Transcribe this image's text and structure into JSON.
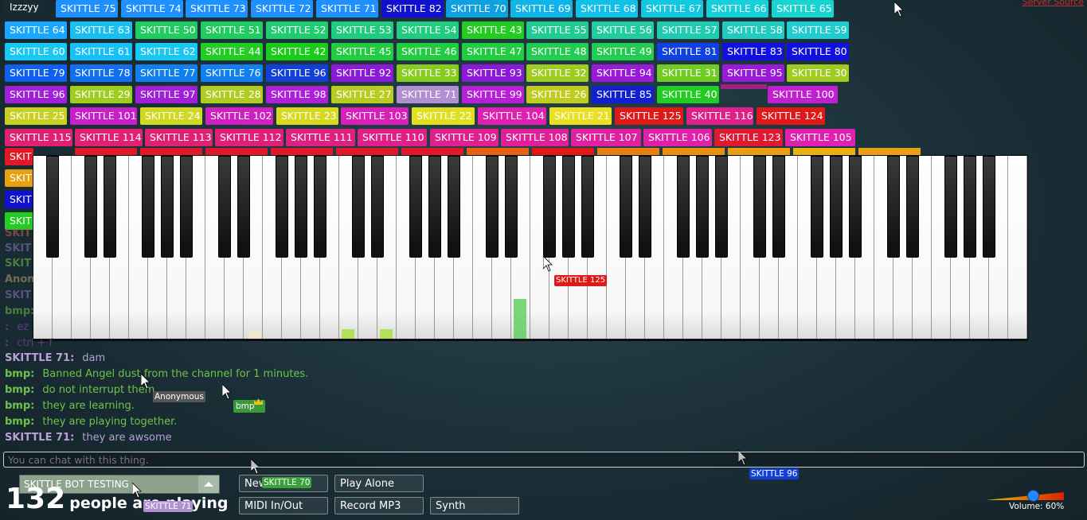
{
  "me_tag": "Izzzyy",
  "server_source": "Server Source",
  "users": [
    {
      "name": "SKITTLE 75",
      "bg": "#1e90ff"
    },
    {
      "name": "SKITTLE 74",
      "bg": "#1e90ff"
    },
    {
      "name": "SKITTLE 73",
      "bg": "#1e90ff"
    },
    {
      "name": "SKITTLE 72",
      "bg": "#1e90ff"
    },
    {
      "name": "SKITTLE 71",
      "bg": "#1e90ff"
    },
    {
      "name": "SKITTLE 82",
      "bg": "#1010d0"
    },
    {
      "name": "SKITTLE 70",
      "bg": "#0fa0e0"
    },
    {
      "name": "SKITTLE 69",
      "bg": "#0fb4e8"
    },
    {
      "name": "SKITTLE 68",
      "bg": "#10c0e8"
    },
    {
      "name": "SKITTLE 67",
      "bg": "#12c8e0"
    },
    {
      "name": "SKITTLE 66",
      "bg": "#15d0d8"
    },
    {
      "name": "SKITTLE 65",
      "bg": "#17d4d0"
    },
    {
      "name": "SKITTLE 64",
      "bg": "#1aa8ff"
    },
    {
      "name": "SKITTLE 63",
      "bg": "#18bff0"
    },
    {
      "name": "SKITTLE 50",
      "bg": "#20cc60"
    },
    {
      "name": "SKITTLE 51",
      "bg": "#20cc60"
    },
    {
      "name": "SKITTLE 52",
      "bg": "#20cc70"
    },
    {
      "name": "SKITTLE 53",
      "bg": "#20cc80"
    },
    {
      "name": "SKITTLE 54",
      "bg": "#20cc80"
    },
    {
      "name": "SKITTLE 43",
      "bg": "#22cc22"
    },
    {
      "name": "SKITTLE 55",
      "bg": "#20cc90"
    },
    {
      "name": "SKITTLE 56",
      "bg": "#20cca0"
    },
    {
      "name": "SKITTLE 57",
      "bg": "#20ccb0"
    },
    {
      "name": "SKITTLE 58",
      "bg": "#20ccc0"
    },
    {
      "name": "SKITTLE 59",
      "bg": "#20ccd0"
    },
    {
      "name": "SKITTLE 60",
      "bg": "#18c8f0"
    },
    {
      "name": "SKITTLE 61",
      "bg": "#18c0f8"
    },
    {
      "name": "SKITTLE 62",
      "bg": "#18c8f0"
    },
    {
      "name": "SKITTLE 44",
      "bg": "#22cc22"
    },
    {
      "name": "SKITTLE 42",
      "bg": "#18cc18"
    },
    {
      "name": "SKITTLE 45",
      "bg": "#22cc40"
    },
    {
      "name": "SKITTLE 46",
      "bg": "#22cc40"
    },
    {
      "name": "SKITTLE 47",
      "bg": "#22cc40"
    },
    {
      "name": "SKITTLE 48",
      "bg": "#22cc50"
    },
    {
      "name": "SKITTLE 49",
      "bg": "#22cc50"
    },
    {
      "name": "SKITTLE 81",
      "bg": "#1040e0"
    },
    {
      "name": "SKITTLE 83",
      "bg": "#1010e0"
    },
    {
      "name": "SKITTLE 80",
      "bg": "#1010e0"
    },
    {
      "name": "SKITTLE 79",
      "bg": "#1060f0"
    },
    {
      "name": "SKITTLE 78",
      "bg": "#1070f0"
    },
    {
      "name": "SKITTLE 77",
      "bg": "#1080f0"
    },
    {
      "name": "SKITTLE 76",
      "bg": "#1080f0"
    },
    {
      "name": "SKITTLE 96",
      "bg": "#1040d8"
    },
    {
      "name": "SKITTLE 92",
      "bg": "#8a1ad8"
    },
    {
      "name": "SKITTLE 33",
      "bg": "#88cc22"
    },
    {
      "name": "SKITTLE 93",
      "bg": "#8a1ad8"
    },
    {
      "name": "SKITTLE 32",
      "bg": "#a0cc22"
    },
    {
      "name": "SKITTLE 94",
      "bg": "#9a1ad8"
    },
    {
      "name": "SKITTLE 31",
      "bg": "#70cc22"
    },
    {
      "name": "SKITTLE 95",
      "bg": "#9a1ad8"
    },
    {
      "name": "SKITTLE 30",
      "bg": "#a0cc22"
    },
    {
      "name": "SKITTLE 96",
      "bg": "#a020d8"
    },
    {
      "name": "SKITTLE 29",
      "bg": "#a0cc22"
    },
    {
      "name": "SKITTLE 97",
      "bg": "#a020d8"
    },
    {
      "name": "SKITTLE 28",
      "bg": "#b0cc22"
    },
    {
      "name": "SKITTLE 98",
      "bg": "#b020d8"
    },
    {
      "name": "SKITTLE 27",
      "bg": "#b8cc22"
    },
    {
      "name": "SKITTLE 71",
      "bg": "#b090d0"
    },
    {
      "name": "SKITTLE 99",
      "bg": "#b820d8"
    },
    {
      "name": "SKITTLE 26",
      "bg": "#c0cc22"
    },
    {
      "name": "SKITTLE 85",
      "bg": "#1020d0"
    },
    {
      "name": "SKITTLE 40",
      "bg": "#22cc22"
    },
    {
      "name": "SKITTLE 100",
      "bg": "#c020d0"
    },
    {
      "name": "SKITTLE 25",
      "bg": "#c8d022"
    },
    {
      "name": "SKITTLE 101",
      "bg": "#c820c8"
    },
    {
      "name": "SKITTLE 24",
      "bg": "#d0d822"
    },
    {
      "name": "SKITTLE 102",
      "bg": "#d020c0"
    },
    {
      "name": "SKITTLE 23",
      "bg": "#d8d820"
    },
    {
      "name": "SKITTLE 103",
      "bg": "#d820b8"
    },
    {
      "name": "SKITTLE 22",
      "bg": "#e0e020"
    },
    {
      "name": "SKITTLE 104",
      "bg": "#e020b0"
    },
    {
      "name": "SKITTLE 21",
      "bg": "#e8e020"
    },
    {
      "name": "SKITTLE 125",
      "bg": "#e01818"
    },
    {
      "name": "SKITTLE 116",
      "bg": "#e0208a"
    },
    {
      "name": "SKITTLE 124",
      "bg": "#e01818"
    },
    {
      "name": "SKITTLE 115",
      "bg": "#e02070"
    },
    {
      "name": "SKITTLE 114",
      "bg": "#e02070"
    },
    {
      "name": "SKITTLE 113",
      "bg": "#e02070"
    },
    {
      "name": "SKITTLE 112",
      "bg": "#e02078"
    },
    {
      "name": "SKITTLE 111",
      "bg": "#e02080"
    },
    {
      "name": "SKITTLE 110",
      "bg": "#e02088"
    },
    {
      "name": "SKITTLE 109",
      "bg": "#e02090"
    },
    {
      "name": "SKITTLE 108",
      "bg": "#e02098"
    },
    {
      "name": "SKITTLE 107",
      "bg": "#e020a0"
    },
    {
      "name": "SKITTLE 106",
      "bg": "#e020a8"
    },
    {
      "name": "SKITTLE 123",
      "bg": "#e01830"
    },
    {
      "name": "SKITTLE 105",
      "bg": "#e020b0"
    }
  ],
  "partial_tags": [
    {
      "name": "SKIT",
      "bg": "#e01828"
    },
    {
      "name": "SKIT",
      "bg": "#e8a010"
    },
    {
      "name": "SKIT",
      "bg": "#1010d0"
    },
    {
      "name": "SKIT",
      "bg": "#22cc22"
    }
  ],
  "key_labels": {
    "skittle125": "SKITTLE 125"
  },
  "chat": [
    {
      "name": "SKITTLE 71:",
      "msg": "dam",
      "color": "#b8a0d8"
    },
    {
      "name": "bmp:",
      "msg": "Banned Angel dust from the channel for 1 minutes.",
      "color": "#6ec24a"
    },
    {
      "name": "bmp:",
      "msg": "do not interrupt them",
      "color": "#6ec24a"
    },
    {
      "name": "bmp:",
      "msg": "they are learning.",
      "color": "#6ec24a"
    },
    {
      "name": "bmp:",
      "msg": "they are playing together.",
      "color": "#6ec24a"
    },
    {
      "name": "SKITTLE 71:",
      "msg": "they are awsome",
      "color": "#b8a0d8"
    }
  ],
  "chat_faded": [
    {
      "name": "SKIT",
      "msg": "",
      "color": "#c06060"
    },
    {
      "name": "SKIT",
      "msg": "",
      "color": "#9070c0"
    },
    {
      "name": "SKIT",
      "msg": "",
      "color": "#6ec24a"
    },
    {
      "name": "Anon",
      "msg": "",
      "color": "#c0a070"
    },
    {
      "name": "SKIT",
      "msg": "",
      "color": "#9070c0"
    },
    {
      "name": "bmp:",
      "msg": "",
      "color": "#6ec24a"
    },
    {
      "name": ":",
      "msg": "ez",
      "color": "#a040c0"
    },
    {
      "name": ":",
      "msg": "ctrl + f",
      "color": "#a040c0"
    }
  ],
  "cursor_labels": {
    "anonymous": "Anonymous",
    "bmp": "bmp",
    "skittle96": "SKITTLE 96",
    "skittle70": "SKITTLE 70",
    "skittle71": "SKITTLE 71"
  },
  "chat_input_placeholder": "You can chat with this thing.",
  "room": {
    "name": "SKITTLE BOT TESTING"
  },
  "buttons": {
    "new": "New",
    "play_alone": "Play Alone",
    "midi": "MIDI In/Out",
    "record": "Record MP3",
    "synth": "Synth"
  },
  "people": {
    "count": "132",
    "label": "people are playing"
  },
  "volume": {
    "label": "Volume: 60%",
    "level": 0.6
  }
}
